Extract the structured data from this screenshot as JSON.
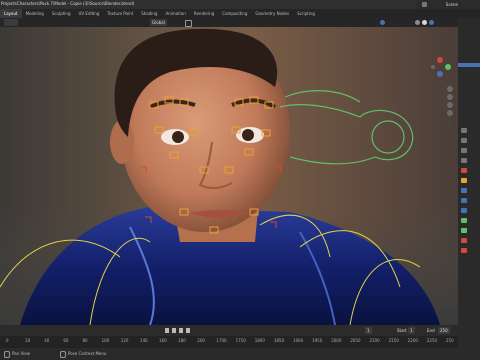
{
  "window": {
    "title": "ProjectsCharacters\\Pack 7\\Model - Copie (3)\\Source\\Blender.blend)",
    "scene_label": "Scene"
  },
  "tabs": [
    "Layout",
    "Modeling",
    "Sculpting",
    "UV Editing",
    "Texture Paint",
    "Shading",
    "Animation",
    "Rendering",
    "Compositing",
    "Geometry Nodes",
    "Scripting"
  ],
  "active_tab": 0,
  "viewport_header": {
    "mode": "Global",
    "pose_options": "Pose Options"
  },
  "timeline": {
    "start_label": "Start",
    "start_value": "1",
    "end_label": "End",
    "end_value": "250",
    "current_frame": "1"
  },
  "ruler": {
    "ticks": [
      "0",
      "20",
      "40",
      "60",
      "80",
      "100",
      "120",
      "140",
      "160",
      "180",
      "200",
      "1700",
      "1750",
      "1800",
      "1850",
      "1900",
      "1950",
      "2000",
      "2050",
      "2100",
      "2150",
      "2200",
      "2250",
      "250"
    ]
  },
  "statusbar": {
    "pan_view": "Pan View",
    "context_menu": "Pose Context Menu"
  },
  "colors": {
    "accent_blue": "#4772b3",
    "rig_orange": "#f0a030",
    "rig_yellow": "#e2d24a",
    "rig_green": "#5fbf6a",
    "rig_red": "#d04a3a"
  }
}
